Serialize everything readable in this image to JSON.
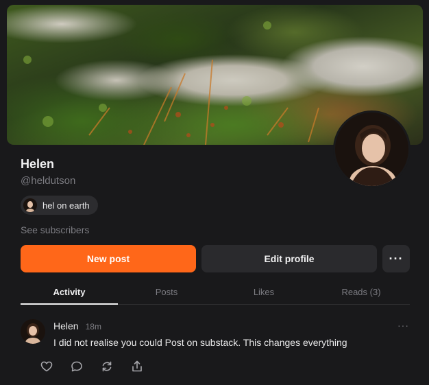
{
  "profile": {
    "name": "Helen",
    "handle": "@heldutson",
    "publication_label": "hel on earth",
    "see_subscribers": "See subscribers"
  },
  "buttons": {
    "new_post": "New post",
    "edit_profile": "Edit profile",
    "more": "···"
  },
  "tabs": [
    {
      "label": "Activity",
      "active": true
    },
    {
      "label": "Posts",
      "active": false
    },
    {
      "label": "Likes",
      "active": false
    },
    {
      "label": "Reads (3)",
      "active": false
    }
  ],
  "post": {
    "author": "Helen",
    "time": "18m",
    "more": "···",
    "body": "I did not realise you could Post on substack. This changes everything",
    "actions": [
      "heart-icon",
      "comment-icon",
      "restack-icon",
      "share-icon"
    ]
  },
  "colors": {
    "background": "#19191b",
    "accent": "#ff6719",
    "button_dark": "#2a2a2d",
    "muted_text": "#7c7c82"
  }
}
